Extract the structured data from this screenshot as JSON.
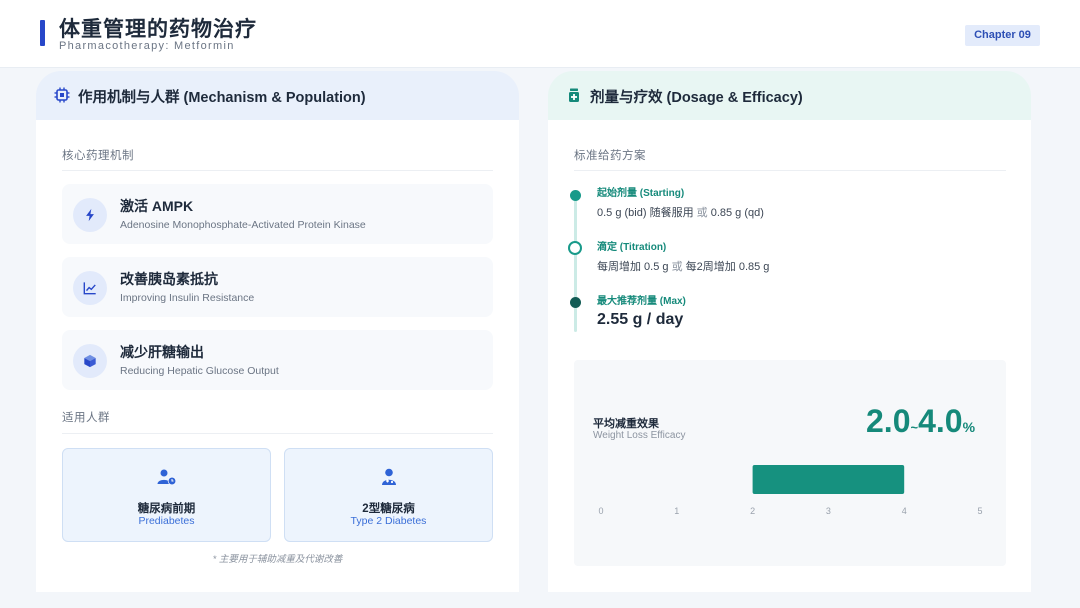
{
  "header": {
    "title": "体重管理的药物治疗",
    "subtitle": "Pharmacotherapy: Metformin",
    "chapter": "Chapter 09"
  },
  "left_panel": {
    "title": "作用机制与人群 (Mechanism & Population)",
    "mechanism_label": "核心药理机制",
    "mechanisms": [
      {
        "title": "激活 AMPK",
        "subtitle": "Adenosine Monophosphate-Activated Protein Kinase",
        "icon": "lightning-icon"
      },
      {
        "title": "改善胰岛素抵抗",
        "subtitle": "Improving Insulin Resistance",
        "icon": "chart-line-icon"
      },
      {
        "title": "减少肝糖输出",
        "subtitle": "Reducing Hepatic Glucose Output",
        "icon": "cube-icon"
      }
    ],
    "population_label": "适用人群",
    "populations": [
      {
        "title": "糖尿病前期",
        "subtitle": "Prediabetes",
        "icon": "user-clock-icon"
      },
      {
        "title": "2型糖尿病",
        "subtitle": "Type 2 Diabetes",
        "icon": "user-doctor-icon"
      }
    ],
    "footnote": "* 主要用于辅助减重及代谢改善"
  },
  "right_panel": {
    "title": "剂量与疗效 (Dosage & Efficacy)",
    "dosage_label": "标准给药方案",
    "steps": [
      {
        "label": "起始剂量 (Starting)",
        "desc_a": "0.5 g (bid) 随餐服用",
        "or": "或",
        "desc_b": "0.85 g (qd)"
      },
      {
        "label": "滴定 (Titration)",
        "desc_a": "每周增加 0.5 g",
        "or": "或",
        "desc_b": "每2周增加 0.85 g"
      },
      {
        "label": "最大推荐剂量 (Max)",
        "value": "2.55 g / day"
      }
    ],
    "efficacy": {
      "label": "平均减重效果",
      "subtitle": "Weight Loss Efficacy",
      "low": "2.0",
      "sep": "~",
      "high": "4.0",
      "unit": "%"
    }
  },
  "colors": {
    "accent_blue": "#2747c9",
    "accent_teal": "#15897a",
    "range_bar": "#16917f"
  },
  "chart_data": {
    "type": "bar",
    "orientation": "horizontal-range",
    "range": [
      2.0,
      4.0
    ],
    "xlim": [
      0,
      5
    ],
    "ticks": [
      "0",
      "1",
      "2",
      "3",
      "4",
      "5"
    ],
    "grid": false
  }
}
